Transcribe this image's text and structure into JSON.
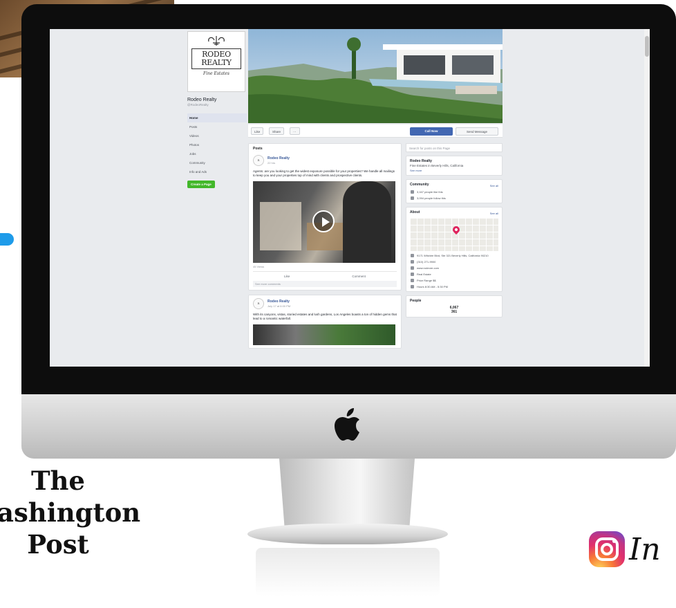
{
  "background": {
    "washington_post": [
      "The",
      "ashington",
      "Post"
    ],
    "instagram_word": "In"
  },
  "facebook": {
    "logo": {
      "main": "RODEO REALTY",
      "tagline": "Fine Estates"
    },
    "page_name": "Rodeo Realty",
    "page_handle": "@RodeoRealty",
    "nav": [
      "Home",
      "Posts",
      "Videos",
      "Photos",
      "Jobs",
      "Community",
      "Info and Ads"
    ],
    "create_page": "Create a Page",
    "action_bar": {
      "like": "Like",
      "share": "Share",
      "more": "···",
      "call_now": "Call Now",
      "send_message": "Send Message"
    },
    "search_placeholder": "Search for posts on this Page",
    "posts_title": "Posts",
    "post1": {
      "author": "Rodeo Realty",
      "time": "22 hrs",
      "text": "Agents: are you looking to get the widest exposure possible for your properties? We handle all mailings to keep you and your properties top of mind with clients and prospective clients.",
      "views": "45 Views",
      "like": "Like",
      "comment": "Comment",
      "comment_bar": "See more comments"
    },
    "post2": {
      "author": "Rodeo Realty",
      "time": "July 17 at 6:00 PM",
      "text": "With its canyons, vistas, storied estates and lush gardens, Los Angeles boasts a ton of hidden gems that lead to a romantic waterfall."
    },
    "about": {
      "name": "Rodeo Realty",
      "sub": "Fine Estates in Beverly Hills, California",
      "link": "See more"
    },
    "community": {
      "title": "Community",
      "see_all": "See all",
      "likes": "3,167 people like this",
      "follows": "3,094 people follow this"
    },
    "info": {
      "title": "About",
      "see_all": "See all",
      "lines": [
        "9171 Wilshire Blvd, Ste 321 Beverly Hills, California 90210",
        "(310) 271-9900",
        "www.rodeore.com",
        "Real Estate",
        "Price Range $$",
        "Hours 8:30 AM - 5:30 PM"
      ]
    },
    "stats": {
      "title": "People",
      "big1": "6,067",
      "big2": "361"
    }
  }
}
